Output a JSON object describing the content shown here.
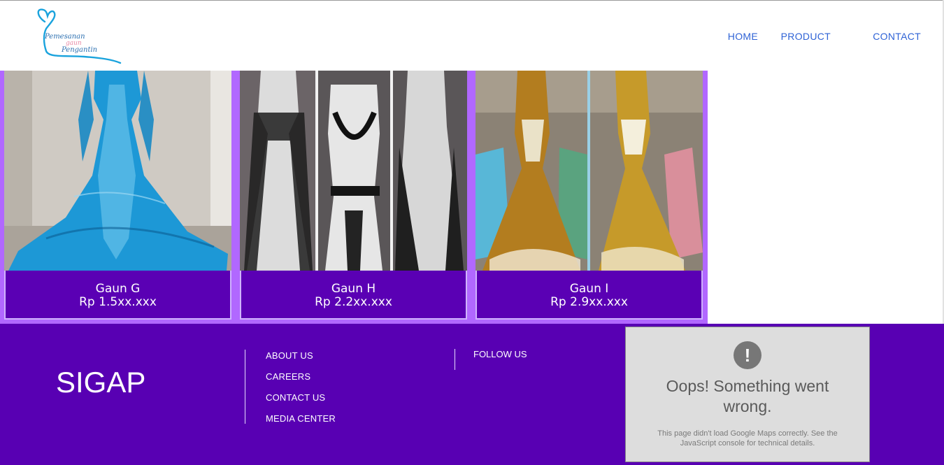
{
  "logo": {
    "line1": "Pemesanan",
    "line2": "gaun",
    "line3": "Pengantin",
    "color": "#1aa3dd"
  },
  "nav": {
    "items": [
      {
        "label": "HOME"
      },
      {
        "label": "PRODUCT"
      },
      {
        "label": "CONTACT"
      }
    ]
  },
  "products": [
    {
      "name": "Gaun G",
      "price": "Rp 1.5xx.xxx",
      "dress_color": "light-blue"
    },
    {
      "name": "Gaun H",
      "price": "Rp 2.2xx.xxx",
      "dress_color": "silver-black"
    },
    {
      "name": "Gaun I",
      "price": "Rp 2.9xx.xxx",
      "dress_color": "gold"
    }
  ],
  "footer": {
    "brand": "SIGAP",
    "links": [
      {
        "label": "ABOUT US"
      },
      {
        "label": "CAREERS"
      },
      {
        "label": "CONTACT US"
      },
      {
        "label": "MEDIA CENTER"
      }
    ],
    "follow_label": "FOLLOW US",
    "map_error": {
      "title": "Oops! Something went wrong.",
      "detail": "This page didn't load Google Maps correctly. See the JavaScript console for technical details."
    }
  },
  "colors": {
    "accent_purple": "#5800b3",
    "card_border": "#b168ff",
    "nav_link": "#2f63d6"
  }
}
